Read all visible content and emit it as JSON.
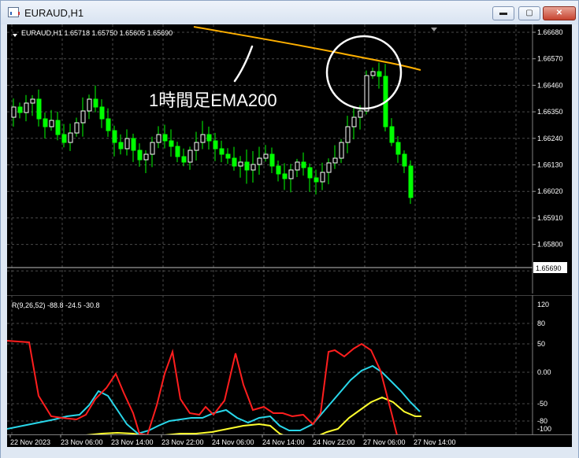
{
  "window": {
    "title": "EURAUD,H1",
    "buttons": {
      "minimize": "▬",
      "maximize": "▢",
      "close": "✕"
    }
  },
  "main_chart": {
    "header": "EURAUD,H1  1.65718  1.65750  1.65605  1.65690",
    "price_labels": [
      "1.66680",
      "1.66570",
      "1.66460",
      "1.66350",
      "1.66240",
      "1.66130",
      "1.66020",
      "1.65910",
      "1.65800",
      "1.65690",
      "1.65580"
    ],
    "current_price": "1.65690",
    "annotation_text": "1時間足EMA200",
    "colors": {
      "bull": "#ffffff",
      "bear": "#00ff00",
      "ema": "#ffb000",
      "grid": "#5a5a5a",
      "price_line": "#c0c0c0"
    }
  },
  "oscillator": {
    "header": "R(9,26,52) -88.8 -24.5 -30.8",
    "levels": [
      "120",
      "80",
      "50",
      "0.00",
      "-50",
      "-80",
      "-100"
    ],
    "colors": {
      "red": "#ff1e1e",
      "cyan": "#29d7ea",
      "yellow": "#ffff2e"
    }
  },
  "time_axis": {
    "labels": [
      "22 Nov 2023",
      "23 Nov 06:00",
      "23 Nov 14:00",
      "23 Nov 22:00",
      "24 Nov 06:00",
      "24 Nov 14:00",
      "24 Nov 22:00",
      "27 Nov 06:00",
      "27 Nov 14:00"
    ]
  }
}
